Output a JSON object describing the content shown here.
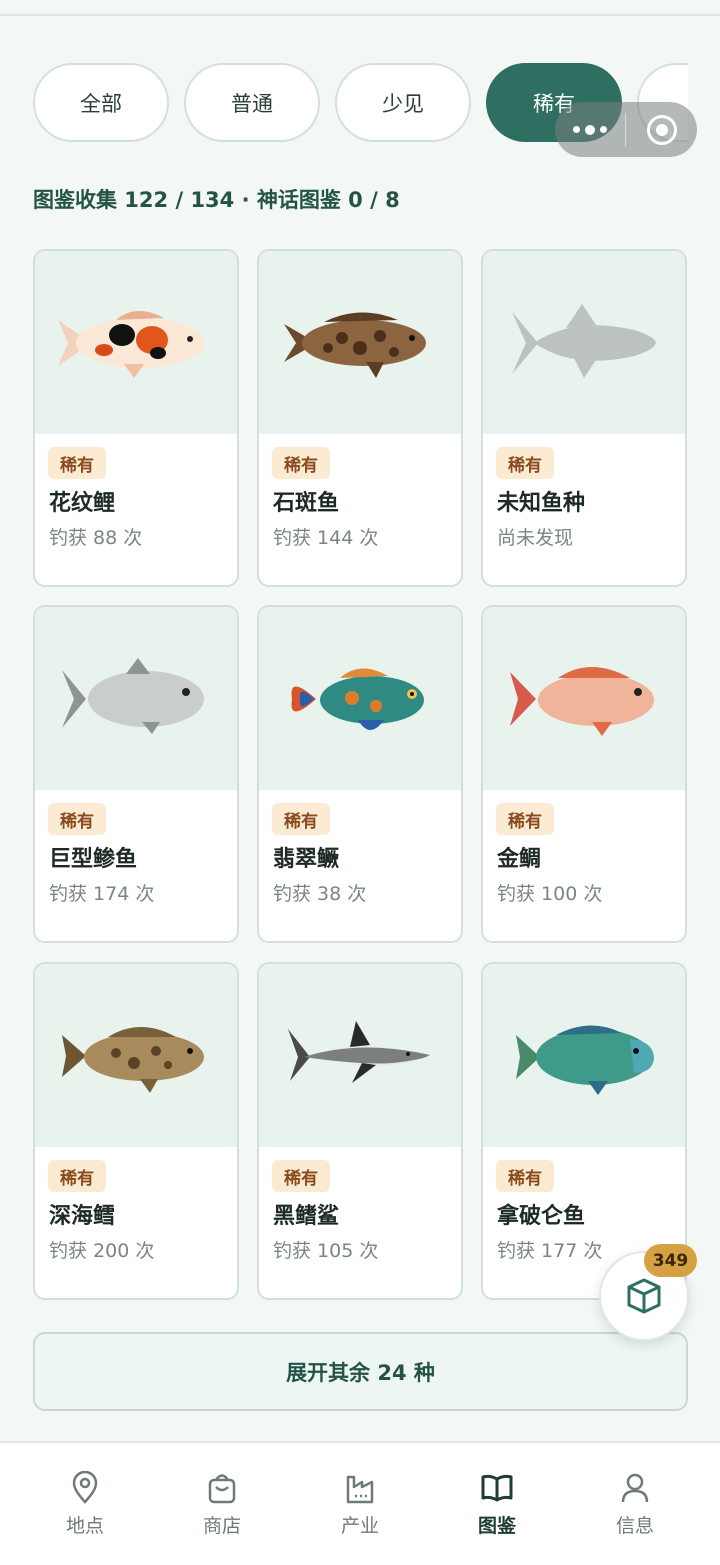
{
  "filters": {
    "tabs": [
      {
        "label": "全部",
        "active": false
      },
      {
        "label": "普通",
        "active": false
      },
      {
        "label": "少见",
        "active": false
      },
      {
        "label": "稀有",
        "active": true
      }
    ]
  },
  "capsule": {
    "more_icon": "more-dots-icon",
    "close_icon": "target-circle-icon"
  },
  "stats": {
    "text": "图鉴收集 122 / 134 · 神话图鉴 0 / 8"
  },
  "cards": [
    {
      "rarity": "稀有",
      "name": "花纹鲤",
      "count": "钓获 88 次",
      "fish": "koi"
    },
    {
      "rarity": "稀有",
      "name": "石斑鱼",
      "count": "钓获 144 次",
      "fish": "grouper"
    },
    {
      "rarity": "稀有",
      "name": "未知鱼种",
      "count": "尚未发现",
      "fish": "silhouette"
    },
    {
      "rarity": "稀有",
      "name": "巨型鲹鱼",
      "count": "钓获 174 次",
      "fish": "trevally"
    },
    {
      "rarity": "稀有",
      "name": "翡翠鳜",
      "count": "钓获 38 次",
      "fish": "mandarin"
    },
    {
      "rarity": "稀有",
      "name": "金鲷",
      "count": "钓获 100 次",
      "fish": "snapper"
    },
    {
      "rarity": "稀有",
      "name": "深海鳕",
      "count": "钓获 200 次",
      "fish": "cod"
    },
    {
      "rarity": "稀有",
      "name": "黑鳍鲨",
      "count": "钓获 105 次",
      "fish": "shark"
    },
    {
      "rarity": "稀有",
      "name": "拿破仑鱼",
      "count": "钓获 177 次",
      "fish": "napoleon"
    }
  ],
  "expand": {
    "label": "展开其余 24 种"
  },
  "fab": {
    "badge": "349",
    "icon": "box-icon"
  },
  "nav": [
    {
      "label": "地点",
      "icon": "location-icon",
      "active": false
    },
    {
      "label": "商店",
      "icon": "shop-bag-icon",
      "active": false
    },
    {
      "label": "产业",
      "icon": "factory-icon",
      "active": false
    },
    {
      "label": "图鉴",
      "icon": "book-icon",
      "active": true
    },
    {
      "label": "信息",
      "icon": "user-icon",
      "active": false
    }
  ]
}
